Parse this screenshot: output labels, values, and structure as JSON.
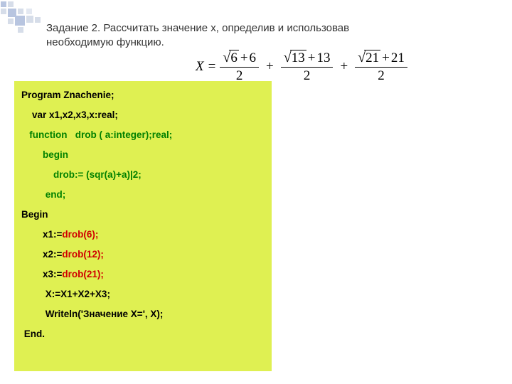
{
  "task": {
    "line1": "Задание 2. Рассчитать значение х, определив и использовав",
    "line2": "необходимую функцию."
  },
  "formula": {
    "lhs": "X",
    "eq": "=",
    "terms": [
      {
        "root": "6",
        "add": "6",
        "den": "2"
      },
      {
        "root": "13",
        "add": "13",
        "den": "2"
      },
      {
        "root": "21",
        "add": "21",
        "den": "2"
      }
    ]
  },
  "code": {
    "l1": "Program Znachenie;",
    "l2": "    var x1,x2,x3,x:real;",
    "l3a": "   ",
    "l3b": "function   drob ( a:integer);real;",
    "l4": "        begin",
    "l5": "            drob:= (sqr(a)+a)|2;",
    "l6": "         end;",
    "l7": "Begin",
    "l8a": "        x1:=",
    "l8b": "drob(6);",
    "l9a": "        x2:=",
    "l9b": "drob(12);",
    "l10a": "        x3:=",
    "l10b": "drob(21);",
    "l11": "         X:=X1+X2+X3;",
    "l12": "         Writeln('Значение Х=', X);",
    "l13": " End."
  }
}
